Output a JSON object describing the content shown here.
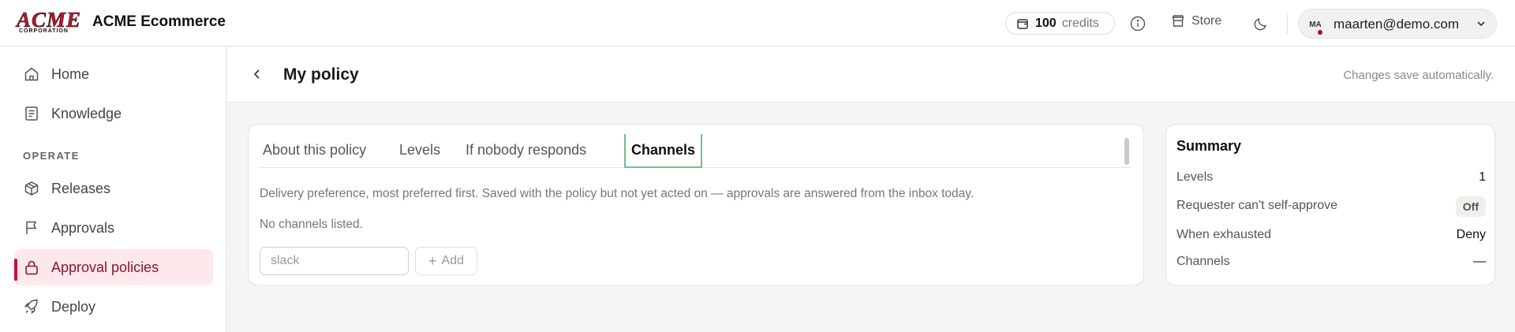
{
  "header": {
    "logo_text": "ACME",
    "logo_subtext": "CORPORATION",
    "app_name": "ACME Ecommerce",
    "credits_value": "100",
    "credits_label": "credits",
    "store_label": "Store",
    "avatar_initials": "MA",
    "user_email": "maarten@demo.com"
  },
  "sidebar": {
    "section_label": "OPERATE",
    "items": [
      {
        "label": "Home",
        "icon": "home-icon"
      },
      {
        "label": "Knowledge",
        "icon": "book-icon"
      },
      {
        "label": "Releases",
        "icon": "box-icon"
      },
      {
        "label": "Approvals",
        "icon": "flag-icon"
      },
      {
        "label": "Approval policies",
        "icon": "lock-icon",
        "active": true
      },
      {
        "label": "Deploy",
        "icon": "rocket-icon"
      }
    ]
  },
  "page": {
    "title": "My policy",
    "autosave_text": "Changes save automatically."
  },
  "tabs": [
    {
      "label": "About this policy"
    },
    {
      "label": "Levels"
    },
    {
      "label": "If nobody responds"
    },
    {
      "label": "Channels",
      "active": true
    }
  ],
  "channels": {
    "description": "Delivery preference, most preferred first. Saved with the policy but not yet acted on — approvals are answered from the inbox today.",
    "empty_text": "No channels listed.",
    "input_placeholder": "slack",
    "input_value": "",
    "add_label": "Add"
  },
  "summary": {
    "title": "Summary",
    "rows": [
      {
        "key": "Levels",
        "value": "1"
      },
      {
        "key": "Requester can't self-approve",
        "value": "Off"
      },
      {
        "key": "When exhausted",
        "value": "Deny"
      },
      {
        "key": "Channels",
        "value": "—"
      }
    ]
  },
  "colors": {
    "brand": "#c8102e",
    "active_nav_bg": "#fde8ec",
    "active_nav_text": "#8a1430",
    "active_tab_outline": "#6ec28a"
  }
}
